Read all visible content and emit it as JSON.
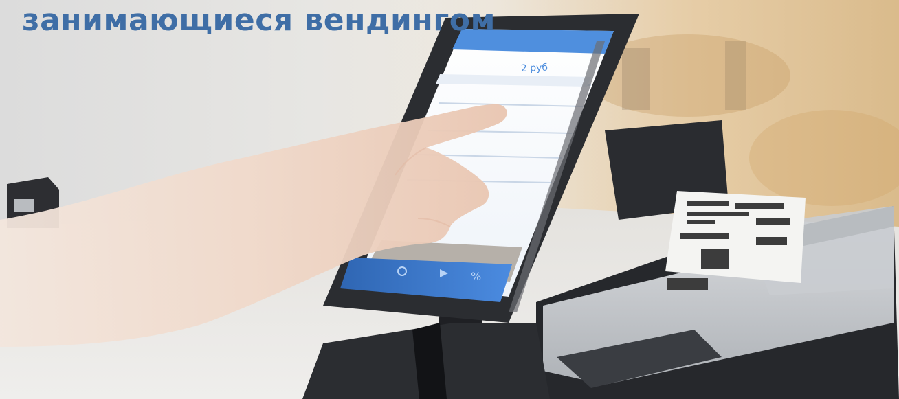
{
  "headline": "занимающиеся вендингом",
  "colors": {
    "headline": "#3f6ea6",
    "tablet_screen_header": "#4f8fde",
    "tablet_nav_bar": "#3e79c8",
    "tablet_frame": "#2b2d31",
    "printer_body": "#2a2c30",
    "receipt_paper": "#f4f4f2"
  },
  "tablet_screen": {
    "amount_text": "2 руб"
  }
}
